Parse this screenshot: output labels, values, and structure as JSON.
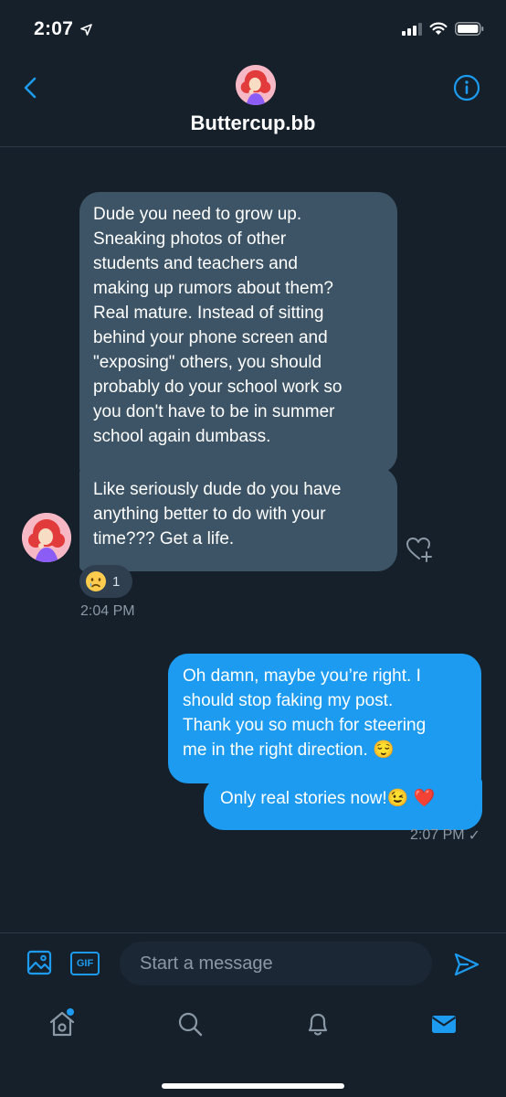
{
  "status_bar": {
    "time": "2:07"
  },
  "header": {
    "contact_name": "Buttercup.bb"
  },
  "messages": {
    "incoming": [
      {
        "lines": [
          "Dude you need to grow up.",
          "Sneaking photos of other",
          "students and teachers and",
          "making up rumors about them?",
          "Real mature. Instead of sitting",
          "behind your phone screen and",
          "\"exposing\" others, you should",
          "probably do your school work so",
          "you don't have to be in summer",
          "school again dumbass."
        ]
      },
      {
        "lines": [
          "Like seriously dude do you have",
          "anything better to do with your",
          "time??? Get a life."
        ]
      }
    ],
    "reaction": {
      "emoji": "😢",
      "count": "1"
    },
    "incoming_timestamp": "2:04 PM",
    "outgoing": [
      {
        "lines": [
          "Oh damn, maybe you’re right. I",
          "should stop faking my post.",
          "Thank you so much for steering",
          "me in the right direction. 😌"
        ]
      },
      {
        "lines": [
          "Only real stories now!😉 ❤️"
        ]
      }
    ],
    "outgoing_timestamp": "2:07 PM",
    "outgoing_status": "✓"
  },
  "composer": {
    "gif_label": "GIF",
    "placeholder": "Start a message"
  },
  "colors": {
    "background": "#15202b",
    "accent": "#1d9bf0",
    "incoming_bubble": "#3d5466",
    "secondary_text": "#8b98a5"
  },
  "icons": {
    "status": [
      "location-arrow-icon",
      "cellular-signal-icon",
      "wifi-icon",
      "battery-icon"
    ],
    "header": [
      "back-chevron-icon",
      "info-icon"
    ],
    "composer": [
      "image-icon",
      "gif-icon",
      "send-icon"
    ],
    "tabs": [
      "home-icon",
      "search-icon",
      "bell-icon",
      "envelope-icon"
    ]
  }
}
